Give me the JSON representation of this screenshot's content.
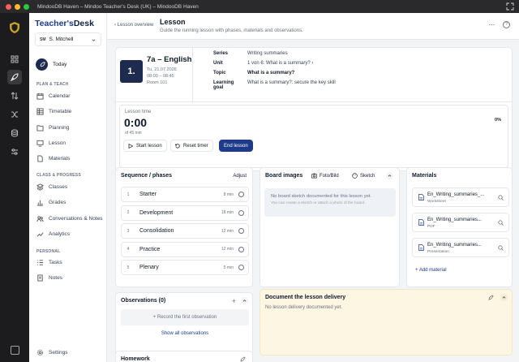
{
  "window": {
    "title": "MindooDB Haven – Mindoo Teacher's Desk (UK) – MindooDB Haven"
  },
  "brand": {
    "part1": "Teacher's",
    "part2": "Desk"
  },
  "user": {
    "initials": "SM",
    "name": "S. Mitchell"
  },
  "sidebar": {
    "today": "Today",
    "sections": {
      "plan": "PLAN & TEACH",
      "class": "CLASS & PROGRESS",
      "personal": "PERSONAL"
    },
    "plan_items": [
      "Calendar",
      "Timetable",
      "Planning",
      "Lesson",
      "Materials"
    ],
    "class_items": [
      "Classes",
      "Grades",
      "Conversations & Notes",
      "Analytics"
    ],
    "personal_items": [
      "Tasks",
      "Notes"
    ],
    "settings": "Settings"
  },
  "header": {
    "back": "‹ Lesson overview",
    "title": "Lesson",
    "subtitle": "Guide the running lesson with phases, materials and observations.",
    "more": "···",
    "help": "?"
  },
  "lesson": {
    "number": "1.",
    "class_name": "7a – English",
    "date": "Tu, 21.07.2026",
    "time": "08:00 – 08:45",
    "room": "Room 101",
    "series_label": "Series",
    "series": "Writing summaries",
    "unit_label": "Unit",
    "unit": "1 von 6: What is a summary?",
    "topic_label": "Topic",
    "topic": "What is a summary?",
    "goal_label1": "Learning",
    "goal_label2": "goal",
    "goal": "What is a summary?: secure the key skill"
  },
  "timer": {
    "label": "Lesson time",
    "value": "0:00",
    "of": "of 45 min",
    "percent": "0%",
    "progress": 0,
    "start": "Start lesson",
    "reset": "Reset timer",
    "end": "End lesson"
  },
  "sequence": {
    "title": "Sequence / phases",
    "adjust": "Adjust",
    "phases": [
      {
        "n": "1",
        "name": "Starter",
        "min": "8 min"
      },
      {
        "n": "2",
        "name": "Development",
        "min": "18 min"
      },
      {
        "n": "3",
        "name": "Consolidation",
        "min": "12 min"
      },
      {
        "n": "4",
        "name": "Practice",
        "min": "12 min"
      },
      {
        "n": "5",
        "name": "Plenary",
        "min": "5 min"
      }
    ]
  },
  "board": {
    "title": "Board images",
    "photo": "Foto/Bild",
    "sketch": "Sketch",
    "empty1": "No board sketch documented for this lesson yet.",
    "empty2": "You can create a sketch or attach a photo of the board."
  },
  "materials": {
    "title": "Materials",
    "items": [
      {
        "name": "En_Writing_summaries_...",
        "type": "Worksheet"
      },
      {
        "name": "En_Writing_summaries...",
        "type": "PDF"
      },
      {
        "name": "En_Writing_summaries...",
        "type": "Presentation"
      }
    ],
    "add": "+ Add material"
  },
  "observations": {
    "title": "Observations (0)",
    "add": "+ Record the first observation",
    "all": "Show all observations"
  },
  "delivery": {
    "title": "Document the lesson delivery",
    "empty": "No lesson delivery documented yet."
  },
  "homework": {
    "title": "Homework"
  }
}
